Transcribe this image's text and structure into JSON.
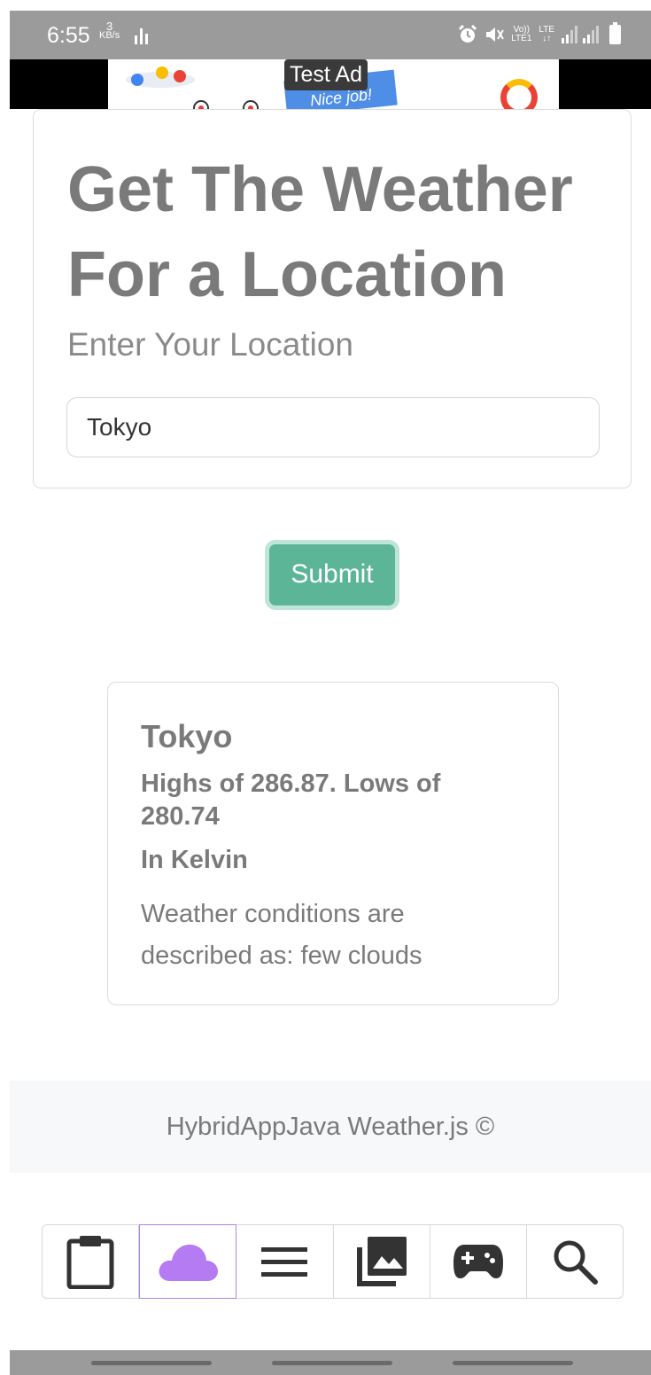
{
  "status_bar": {
    "time": "6:55",
    "net_speed_value": "3",
    "net_speed_unit": "KB/s",
    "volte_top": "Vo))",
    "volte_bottom": "LTE1",
    "lte_label": "LTE",
    "icons": [
      "signal-activity-icon",
      "alarm-icon",
      "mute-icon",
      "signal-bars-icon",
      "battery-icon"
    ]
  },
  "ad": {
    "label": "Test Ad",
    "banner_text": "Nice job!"
  },
  "form": {
    "title": "Get The Weather For a Location",
    "subtitle": "Enter Your Location",
    "location_value": "Tokyo",
    "submit_label": "Submit"
  },
  "result": {
    "city": "Tokyo",
    "temps": "Highs of 286.87. Lows of 280.74",
    "unit": "In Kelvin",
    "description": "Weather conditions are described as: few clouds"
  },
  "footer": {
    "text": "HybridAppJava Weather.js ©"
  },
  "tabs": [
    {
      "icon": "clipboard-icon",
      "active": false
    },
    {
      "icon": "cloud-icon",
      "active": true
    },
    {
      "icon": "menu-icon",
      "active": false
    },
    {
      "icon": "photo-library-icon",
      "active": false
    },
    {
      "icon": "gamepad-icon",
      "active": false
    },
    {
      "icon": "search-icon",
      "active": false
    }
  ],
  "colors": {
    "accent_green": "#5db597",
    "active_tab_purple": "#b083e8",
    "cloud_purple": "#b57bf3",
    "text_gray": "#7a7a7a"
  }
}
